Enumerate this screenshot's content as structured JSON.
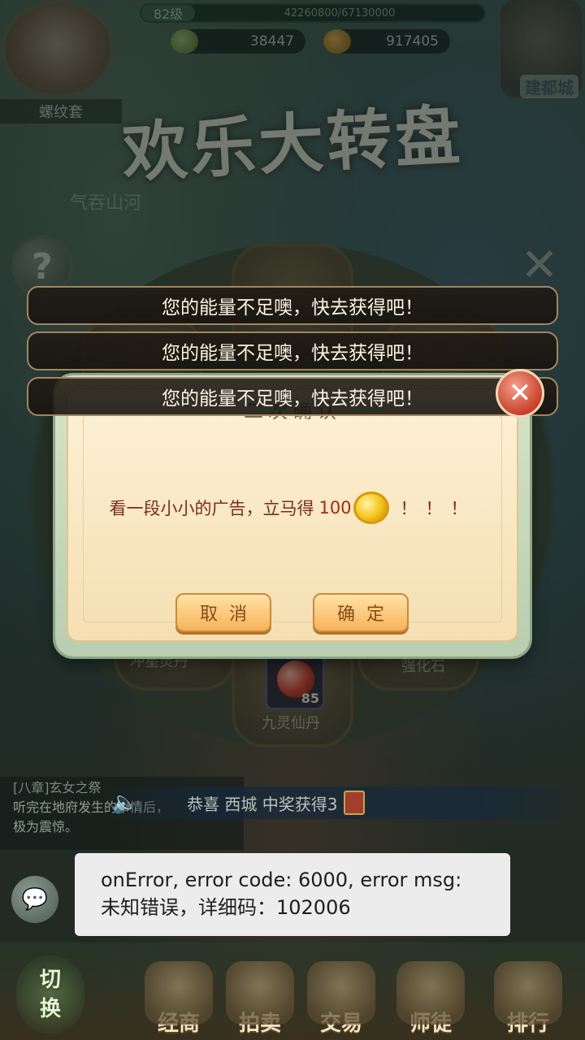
{
  "hud": {
    "level": "82级",
    "exp": "42260800/67130000",
    "player_name": "螺纹套",
    "jade": "38447",
    "gold": "917405",
    "top_right_label": "建都城"
  },
  "event": {
    "title": "欢乐大转盘",
    "subtitle": "气吞山河"
  },
  "wheel": {
    "center_item_name": "九灵仙丹",
    "center_item_count": "85",
    "left_item_name": "冲星灵丹",
    "right_item_name": "强化石"
  },
  "toasts": [
    "您的能量不足噢，快去获得吧！",
    "您的能量不足噢，快去获得吧！",
    "您的能量不足噢，快去获得吧！"
  ],
  "dialog": {
    "title": "二次确认",
    "message": "看一段小小的广告，立马得",
    "amount": "100",
    "suffix": "！！！",
    "cancel_label": "取消",
    "confirm_label": "确定",
    "close_symbol": "✕"
  },
  "chat": {
    "chapter": "[八章]玄女之祭",
    "line1": "听完在地府发生的事情后，",
    "line2": "极为震惊。"
  },
  "broadcast": {
    "text": "恭喜 西城 中奖获得3"
  },
  "system_toast": {
    "text": "onError, error code: 6000, error msg: 未知错误，详细码：102006"
  },
  "dock": {
    "switch_label_1": "切",
    "switch_label_2": "换",
    "items": [
      "经商",
      "拍卖",
      "交易",
      "师徒",
      "排行"
    ]
  },
  "colors": {
    "toast_border": "#a08660",
    "dialog_bg": "#fdf1d6",
    "button_fill": "#f6b35a",
    "close_red": "#c8412c"
  }
}
